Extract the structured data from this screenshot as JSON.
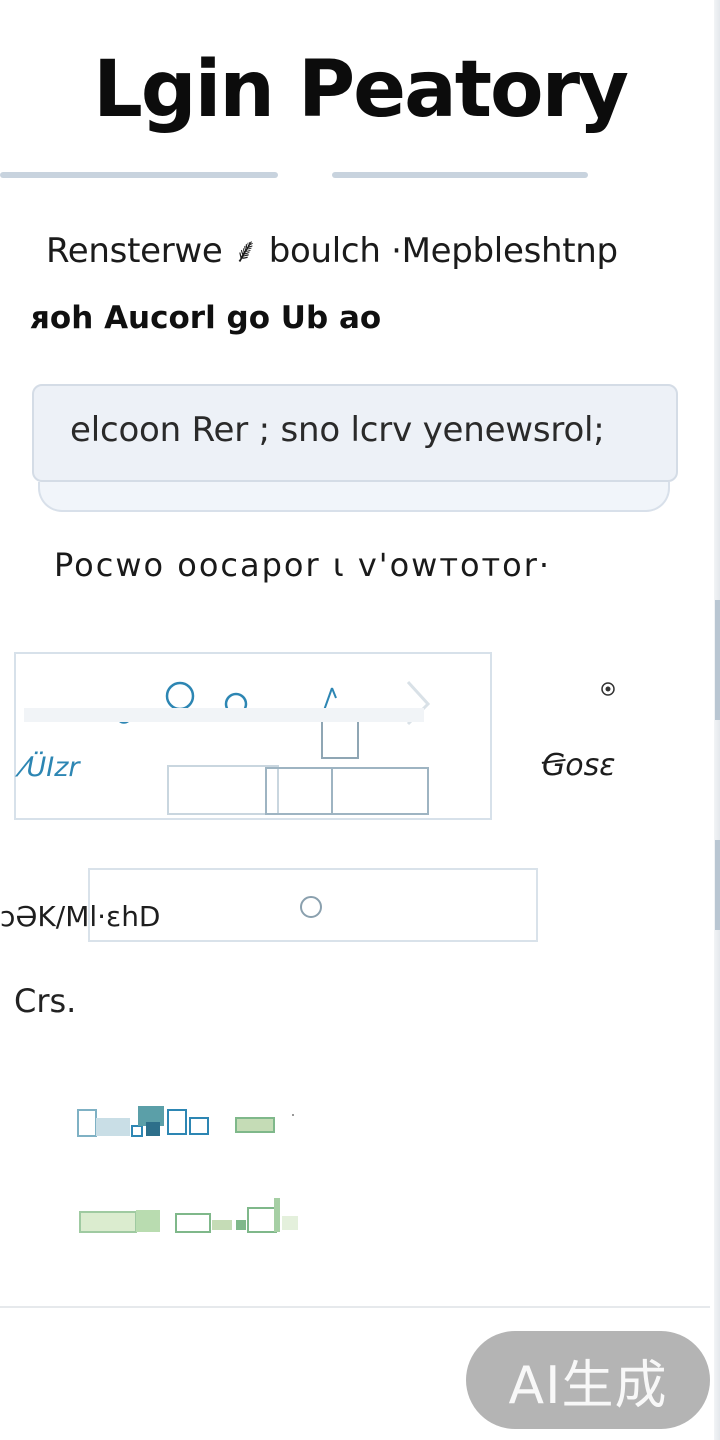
{
  "header": {
    "title": "Lgin Peatory"
  },
  "intro": {
    "subtitle": "Rensterwe ⸙ boulch ·Mepbleshtnp",
    "prompt": "ᴙoh Aucorl go Ub ao"
  },
  "field": {
    "value": "elcoon Rer ; sno lcrv yenewsrol;"
  },
  "section": {
    "heading": "Pocwo   oocapor   ι v'owтoтor·"
  },
  "illustration": {
    "caption": "⁄ÜIzr",
    "side_label": "Ꞡosɛ"
  },
  "search": {
    "label": "ɔƏK/Ml·ɛhD"
  },
  "cta": {
    "label": "Crs."
  },
  "badge": {
    "label": "AI生成"
  },
  "colors": {
    "accent_blue": "#2d86b3",
    "accent_green": "#7fb88a",
    "badge_gray": "#b4b4b4",
    "field_bg": "#edf1f7"
  },
  "icons": {
    "target": "target-icon",
    "search": "search-icon"
  }
}
